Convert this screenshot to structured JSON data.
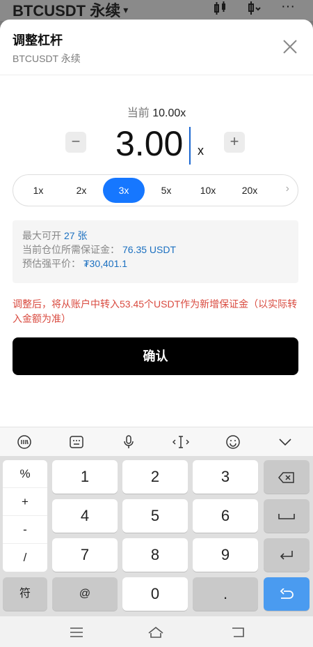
{
  "topbar": {
    "title": "BTCUSDT 永续",
    "caret": "▾"
  },
  "sheet": {
    "title": "调整杠杆",
    "subtitle": "BTCUSDT 永续"
  },
  "leverage": {
    "current_label": "当前",
    "current_value": "10.00x",
    "value": "3.00",
    "unit": "x",
    "minus": "−",
    "plus": "+"
  },
  "presets": {
    "items": [
      "1x",
      "2x",
      "3x",
      "5x",
      "10x",
      "20x"
    ],
    "active_index": 2,
    "next": "›"
  },
  "info": {
    "max_open_label": "最大可开",
    "max_open_value": "27 张",
    "margin_label": "当前仓位所需保证金：",
    "margin_value": "76.35 USDT",
    "liq_label": "预估强平价：",
    "liq_value": "₮30,401.1"
  },
  "warning": "调整后，将从账户中转入53.45个USDT作为新增保证金（以实际转入金额为准）",
  "confirm_label": "确认",
  "keyboard": {
    "toolbar_icons": [
      "keyboard-switch-icon",
      "keyboard-icon",
      "microphone-icon",
      "cursor-icon",
      "emoji-icon",
      "chevron-down-icon"
    ],
    "symbols": [
      "%",
      "+",
      "-",
      "/"
    ],
    "keys": [
      "1",
      "2",
      "3",
      "4",
      "5",
      "6",
      "7",
      "8",
      "9",
      "0",
      "."
    ],
    "sym_key": "符",
    "at_key": "@"
  },
  "colors": {
    "accent": "#1677ff",
    "value_blue": "#1a6fc0",
    "warning_red": "#d94a3f",
    "confirm_bg": "#000000",
    "enter_blue": "#4a9bf0"
  }
}
